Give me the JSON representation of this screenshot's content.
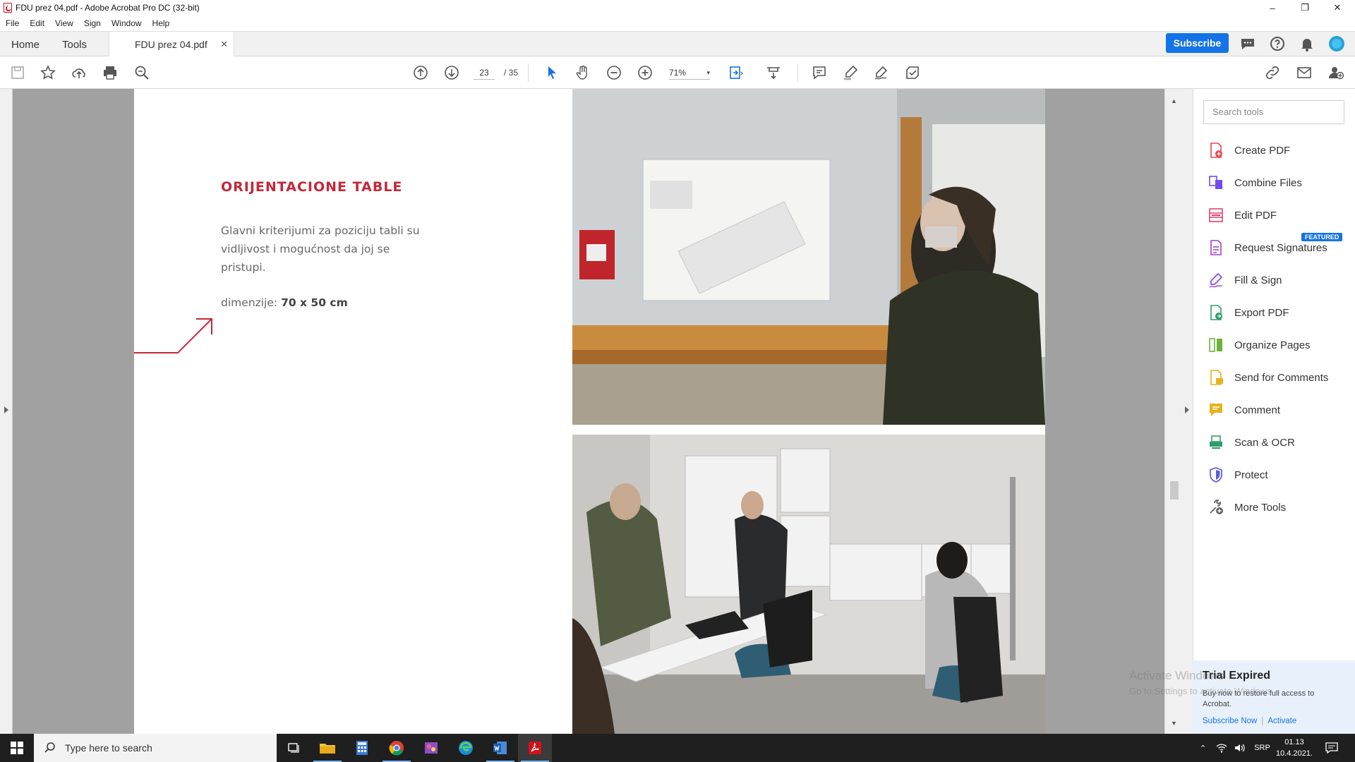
{
  "window": {
    "title": "FDU prez 04.pdf - Adobe Acrobat Pro DC (32-bit)",
    "minimize": "–",
    "restore": "❐",
    "close": "✕"
  },
  "menu": [
    "File",
    "Edit",
    "View",
    "Sign",
    "Window",
    "Help"
  ],
  "tabs": {
    "home": "Home",
    "tools": "Tools",
    "document": "FDU prez 04.pdf",
    "close": "✕"
  },
  "header": {
    "subscribe": "Subscribe"
  },
  "toolbar": {
    "current_page": "23",
    "total_pages": "/ 35",
    "zoom": "71%",
    "zoom_caret": "▾"
  },
  "document": {
    "heading": "ORIJENTACIONE TABLE",
    "paragraph": "Glavni kriterijumi za poziciju tabli su vidljivost i mogućnost da joj se pristupi.",
    "dims_label": "dimenzije:",
    "dims_value": "70 x 50 cm"
  },
  "right_panel": {
    "search_placeholder": "Search tools",
    "tools": [
      {
        "label": "Create PDF",
        "icon": "create-pdf-icon",
        "color": "#e34850"
      },
      {
        "label": "Combine Files",
        "icon": "combine-files-icon",
        "color": "#6e4cf0"
      },
      {
        "label": "Edit PDF",
        "icon": "edit-pdf-icon",
        "color": "#e3406d"
      },
      {
        "label": "Request Signatures",
        "icon": "request-signatures-icon",
        "color": "#a63fbd"
      },
      {
        "label": "Fill & Sign",
        "icon": "fill-sign-icon",
        "color": "#8f49e6"
      },
      {
        "label": "Export PDF",
        "icon": "export-pdf-icon",
        "color": "#2e9e6b"
      },
      {
        "label": "Organize Pages",
        "icon": "organize-pages-icon",
        "color": "#6fb23a"
      },
      {
        "label": "Send for Comments",
        "icon": "send-comments-icon",
        "color": "#e6b31b"
      },
      {
        "label": "Comment",
        "icon": "comment-icon",
        "color": "#e6b31b"
      },
      {
        "label": "Scan & OCR",
        "icon": "scan-ocr-icon",
        "color": "#2e9e6b"
      },
      {
        "label": "Protect",
        "icon": "protect-icon",
        "color": "#5c5cd6"
      },
      {
        "label": "More Tools",
        "icon": "more-tools-icon",
        "color": "#666666"
      }
    ],
    "featured_badge": "FEATURED"
  },
  "trial": {
    "title": "Trial Expired",
    "message": "Buy now to restore full access to Acrobat.",
    "subscribe_link": "Subscribe Now",
    "divider": "|",
    "activate_link": "Activate"
  },
  "watermark": {
    "line1": "Activate Windows",
    "line2": "Go to Settings to activate Windows."
  },
  "taskbar": {
    "search_placeholder": "Type here to search",
    "language": "SRP",
    "time": "01.13",
    "date": "10.4.2021."
  },
  "colors": {
    "accent": "#1473e6",
    "heading_red": "#c2283a"
  }
}
